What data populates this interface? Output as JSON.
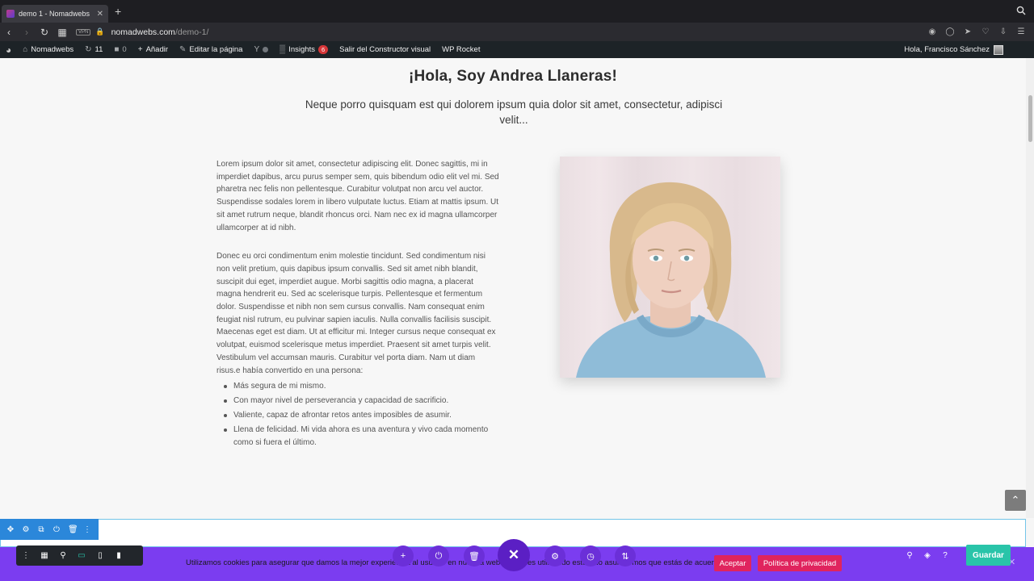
{
  "browser": {
    "tab_title": "demo 1 - Nomadwebs",
    "tab_close": "✕",
    "new_tab": "+",
    "url_host": "nomadwebs.com",
    "url_path": "/demo-1/",
    "vpn_label": "VPN"
  },
  "adminbar": {
    "site_name": "Nomadwebs",
    "updates_count": "11",
    "comments_count": "0",
    "add_label": "Añadir",
    "edit_label": "Editar la página",
    "insights_label": "Insights",
    "insights_badge": "6",
    "exit_builder_label": "Salir del Constructor visual",
    "wp_rocket_label": "WP Rocket",
    "greeting": "Hola, Francisco Sánchez"
  },
  "content": {
    "title": "¡Hola, Soy Andrea Llaneras!",
    "subtitle": "Neque porro quisquam est qui dolorem ipsum quia dolor sit amet, consectetur, adipisci velit...",
    "paragraph1": "Lorem ipsum dolor sit amet, consectetur adipiscing elit. Donec sagittis, mi in imperdiet dapibus, arcu purus semper sem, quis bibendum odio elit vel mi. Sed pharetra nec felis non pellentesque. Curabitur volutpat non arcu vel auctor. Suspendisse sodales lorem in libero vulputate luctus. Etiam at mattis ipsum. Ut sit amet rutrum neque, blandit rhoncus orci. Nam nec ex id magna ullamcorper ullamcorper at id nibh.",
    "paragraph2": "Donec eu orci condimentum enim molestie tincidunt. Sed condimentum nisi non velit pretium, quis dapibus ipsum convallis. Sed sit amet nibh blandit, suscipit dui eget, imperdiet augue. Morbi sagittis odio magna, a placerat magna hendrerit eu. Sed ac scelerisque turpis. Pellentesque et fermentum dolor. Suspendisse et nibh non sem cursus convallis. Nam consequat enim feugiat nisl rutrum, eu pulvinar sapien iaculis. Nulla convallis facilisis suscipit. Maecenas eget est diam. Ut at efficitur mi. Integer cursus neque consequat ex volutpat, euismod scelerisque metus imperdiet. Praesent sit amet turpis velit. Vestibulum vel accumsan mauris. Curabitur vel porta diam. Nam ut diam risus.e había convertido en una persona:",
    "list": [
      "Más segura de mi mismo.",
      "Con mayor nivel de perseverancia y capacidad de sacrificio.",
      "Valiente, capaz de afrontar retos antes imposibles de asumir.",
      "Llena de felicidad. Mi vida ahora es una aventura y vivo cada momento como si fuera el último."
    ]
  },
  "cookie": {
    "text": "Utilizamos cookies para asegurar que damos la mejor experiencia al usuario en nuestra web. Si sigues utilizando este sitio asumiremos que estás de acuerdo.",
    "accept_label": "Aceptar",
    "policy_label": "Política de privacidad",
    "close": "✕"
  },
  "builder": {
    "save_label": "Guardar",
    "close_symbol": "✕",
    "add_symbol": "+"
  },
  "colors": {
    "divi_purple": "#7b3df0",
    "divi_blue": "#2b87da",
    "divi_green": "#29c4a9",
    "accept_pink": "#e0245e",
    "wp_admin": "#1d2327"
  }
}
